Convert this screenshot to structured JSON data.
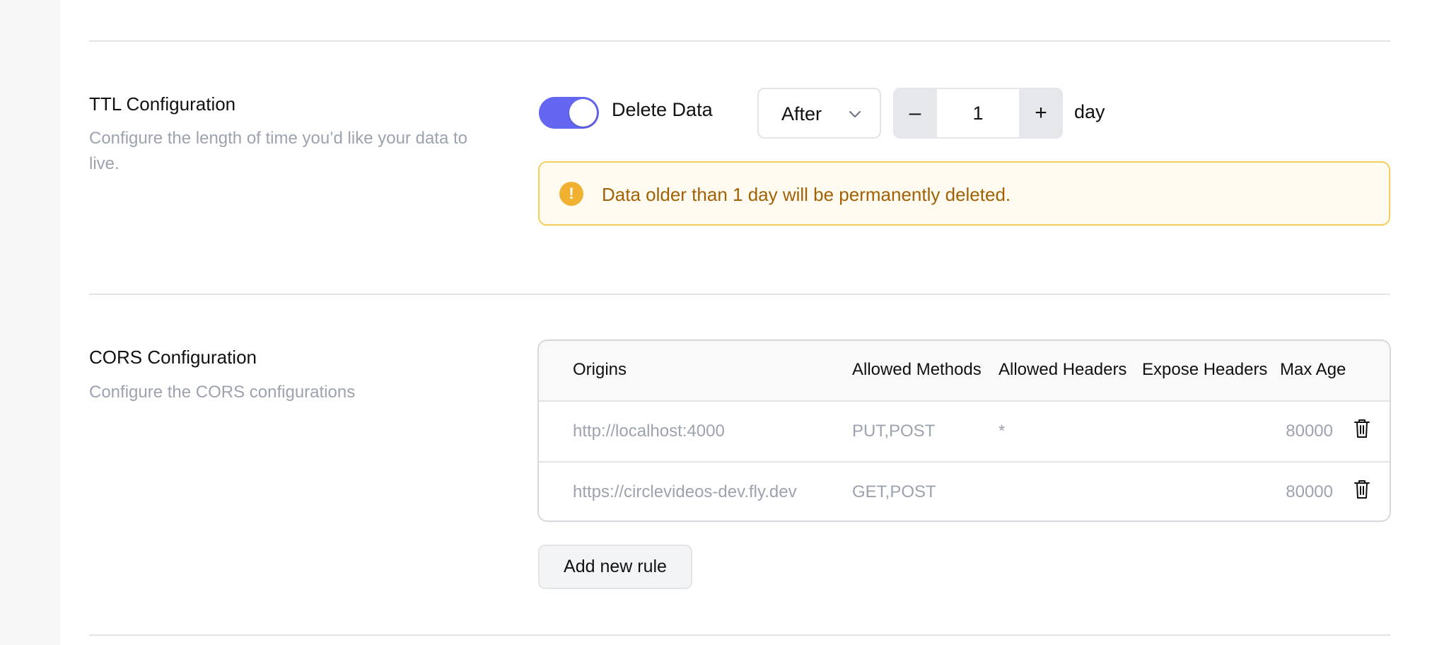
{
  "ttl": {
    "title": "TTL Configuration",
    "description": "Configure the length of time you’d like your data to live.",
    "toggle_label": "Delete Data",
    "toggle_on": true,
    "select_value": "After",
    "stepper_minus": "–",
    "stepper_value": "1",
    "stepper_plus": "+",
    "unit": "day",
    "alert_icon": "!",
    "alert_text": "Data older than 1 day will be permanently deleted."
  },
  "cors": {
    "title": "CORS Configuration",
    "description": "Configure the CORS configurations",
    "headers": {
      "origins": "Origins",
      "methods": "Allowed Methods",
      "allowed_headers": "Allowed Headers",
      "expose_headers": "Expose Headers",
      "max_age": "Max Age"
    },
    "rules": [
      {
        "origin": "http://localhost:4000",
        "methods": "PUT,POST",
        "allowed_headers": "*",
        "expose_headers": "",
        "max_age": "80000"
      },
      {
        "origin": "https://circlevideos-dev.fly.dev",
        "methods": "GET,POST",
        "allowed_headers": "",
        "expose_headers": "",
        "max_age": "80000"
      }
    ],
    "add_button": "Add new rule"
  },
  "icons": {
    "toggle": "toggle-switch",
    "select": "chevron-down-icon",
    "alert": "warning-icon",
    "delete": "trash-icon"
  },
  "colors": {
    "accent": "#6366f1",
    "warning_border": "#f3ce5a",
    "warning_bg": "#fffbf0",
    "warning_text": "#a16207",
    "warning_icon": "#f0b131",
    "muted_text": "#9ca3af"
  }
}
